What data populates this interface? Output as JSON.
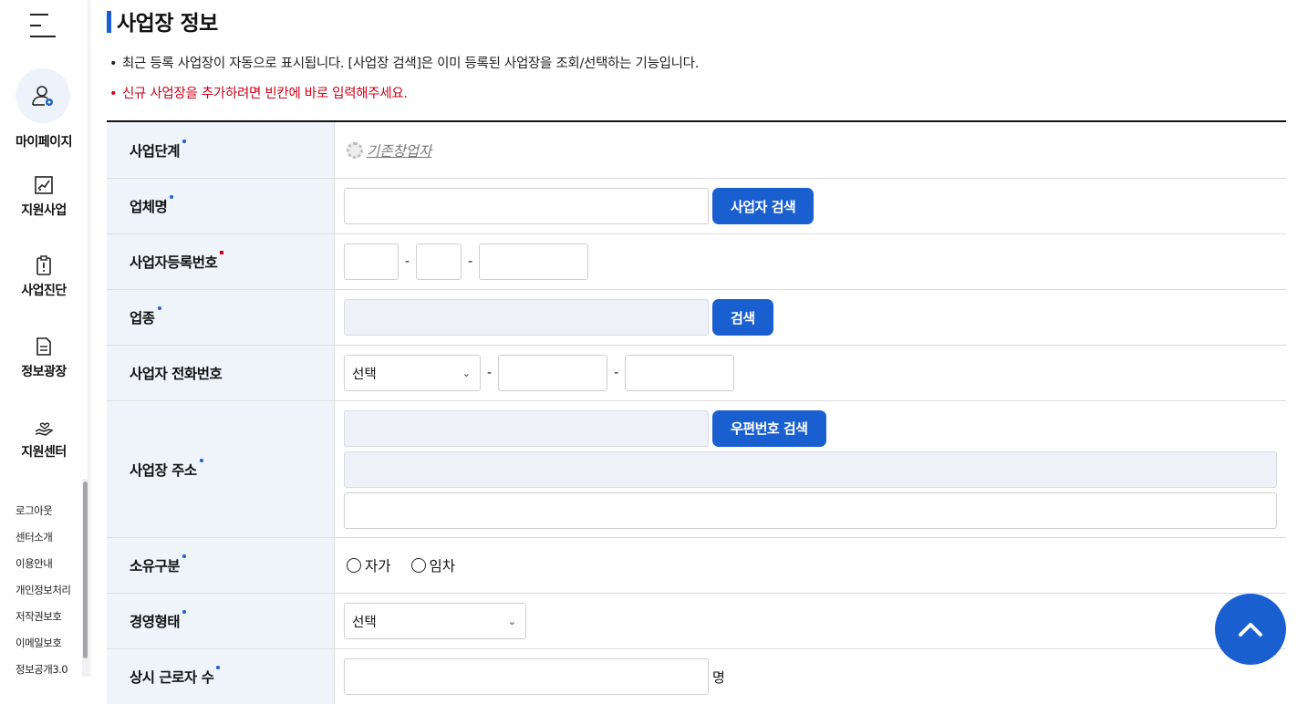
{
  "sidebar": {
    "menu_icon": "hamburger-menu-icon",
    "items": [
      {
        "label": "마이페이지",
        "icon": "user-settings-icon"
      },
      {
        "label": "지원사업",
        "icon": "chart-icon"
      },
      {
        "label": "사업진단",
        "icon": "clipboard-alert-icon"
      },
      {
        "label": "정보광장",
        "icon": "document-icon"
      },
      {
        "label": "지원센터",
        "icon": "hand-heart-icon"
      }
    ],
    "footer_links": [
      "로그아웃",
      "센터소개",
      "이용안내",
      "개인정보처리",
      "저작권보호",
      "이메일보호",
      "정보공개3.0"
    ]
  },
  "page": {
    "title": "사업장 정보",
    "notice1": "최근 등록 사업장이 자동으로 표시됩니다. [사업장 검색]은 이미 등록된 사업장을 조회/선택하는 기능입니다.",
    "notice2": "신규 사업장을 추가하려면 빈칸에 바로 입력해주세요.",
    "bullet": "•"
  },
  "form": {
    "business_stage": {
      "label": "사업단계",
      "value": "기존창업자"
    },
    "company_name": {
      "label": "업체명",
      "value": "",
      "button": "사업자 검색"
    },
    "business_reg_no": {
      "label": "사업자등록번호",
      "part1": "",
      "part2": "",
      "part3": "",
      "dash": "-"
    },
    "industry": {
      "label": "업종",
      "value": "",
      "button": "검색"
    },
    "phone": {
      "label": "사업자 전화번호",
      "select": "선택",
      "part2": "",
      "part3": "",
      "dash": "-"
    },
    "address": {
      "label": "사업장 주소",
      "zip": "",
      "button": "우편번호 검색",
      "addr1": "",
      "addr2": ""
    },
    "ownership": {
      "label": "소유구분",
      "options": [
        "자가",
        "임차"
      ]
    },
    "management": {
      "label": "경영형태",
      "select": "선택"
    },
    "employees": {
      "label": "상시 근로자 수",
      "value": "",
      "unit": "명"
    }
  },
  "colors": {
    "accent": "#1a5fd0",
    "warning": "#d0021b",
    "header_bg": "#eff4fb"
  }
}
